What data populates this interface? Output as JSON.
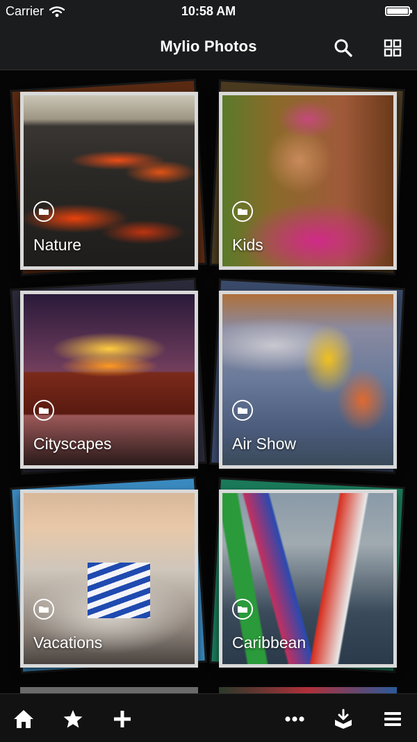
{
  "status": {
    "carrier": "Carrier",
    "time": "10:58 AM"
  },
  "nav": {
    "title": "Mylio Photos",
    "search_icon": "search-icon",
    "grid_icon": "grid-view-icon"
  },
  "albums": [
    {
      "name": "Nature"
    },
    {
      "name": "Kids"
    },
    {
      "name": "Cityscapes"
    },
    {
      "name": "Air Show"
    },
    {
      "name": "Vacations"
    },
    {
      "name": "Caribbean"
    }
  ],
  "tabbar": {
    "items": [
      "home-icon",
      "star-icon",
      "add-icon",
      "more-icon",
      "import-icon",
      "menu-icon"
    ]
  },
  "colors": {
    "bar_bg": "#1b1c1d",
    "frame": "#d9d9d9",
    "background": "#050505"
  }
}
